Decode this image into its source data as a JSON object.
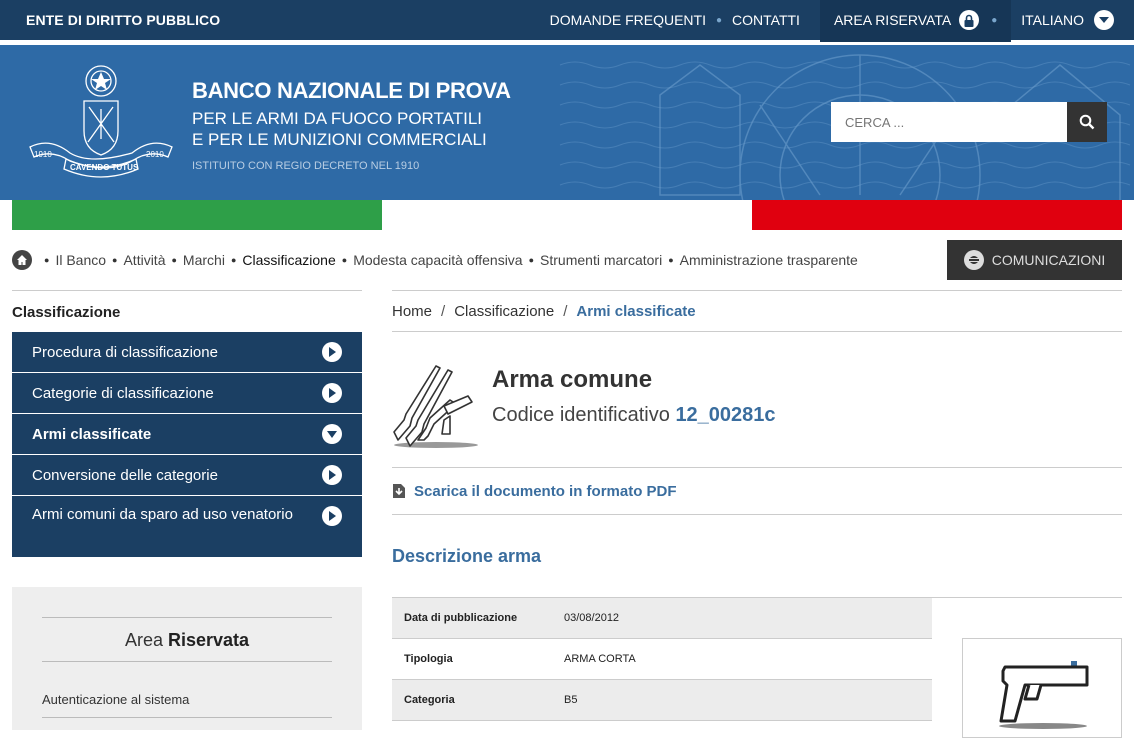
{
  "topbar": {
    "ente": "ENTE DI DIRITTO PUBBLICO",
    "faq": "DOMANDE FREQUENTI",
    "contacts": "CONTATTI",
    "reserved": "AREA RISERVATA",
    "language": "ITALIANO"
  },
  "header": {
    "title": "BANCO NAZIONALE DI PROVA",
    "subtitle1": "PER LE ARMI DA FUOCO PORTATILI",
    "subtitle2": "E PER LE MUNIZIONI COMMERCIALI",
    "tagline": "ISTITUITO CON REGIO DECRETO NEL 1910",
    "logo_text": {
      "motto": "CAVENDO TUTUS",
      "year_left": "1910",
      "year_right": "2010"
    }
  },
  "search": {
    "placeholder": "CERCA ..."
  },
  "flag_colors": {
    "green": "#2e9f48",
    "white": "#ffffff",
    "red": "#e0000f"
  },
  "menu": {
    "items": [
      "Il Banco",
      "Attività",
      "Marchi",
      "Classificazione",
      "Modesta capacità offensiva",
      "Strumenti marcatori",
      "Amministrazione trasparente"
    ],
    "communications": "COMUNICAZIONI"
  },
  "sidebar": {
    "title": "Classificazione",
    "items": [
      {
        "label": "Procedura di classificazione"
      },
      {
        "label": "Categorie di classificazione"
      },
      {
        "label": "Armi classificate"
      },
      {
        "label": "Conversione delle categorie"
      },
      {
        "label": "Armi comuni da sparo ad uso venatorio"
      }
    ]
  },
  "area_riservata": {
    "title_a": "Area",
    "title_b": "Riservata",
    "link": "Autenticazione al sistema"
  },
  "breadcrumb": {
    "home": "Home",
    "section": "Classificazione",
    "current": "Armi classificate"
  },
  "weapon": {
    "title": "Arma comune",
    "code_label": "Codice identificativo",
    "code": "12_00281c",
    "pdf_link": "Scarica il documento in formato PDF",
    "desc_title": "Descrizione arma",
    "rows": [
      {
        "key": "Data di pubblicazione",
        "value": "03/08/2012"
      },
      {
        "key": "Tipologia",
        "value": "ARMA CORTA"
      },
      {
        "key": "Categoria",
        "value": "B5"
      }
    ]
  },
  "colors": {
    "navy": "#1b3f63",
    "header_blue": "#2e6aa6",
    "link_blue": "#3a6d9e"
  }
}
